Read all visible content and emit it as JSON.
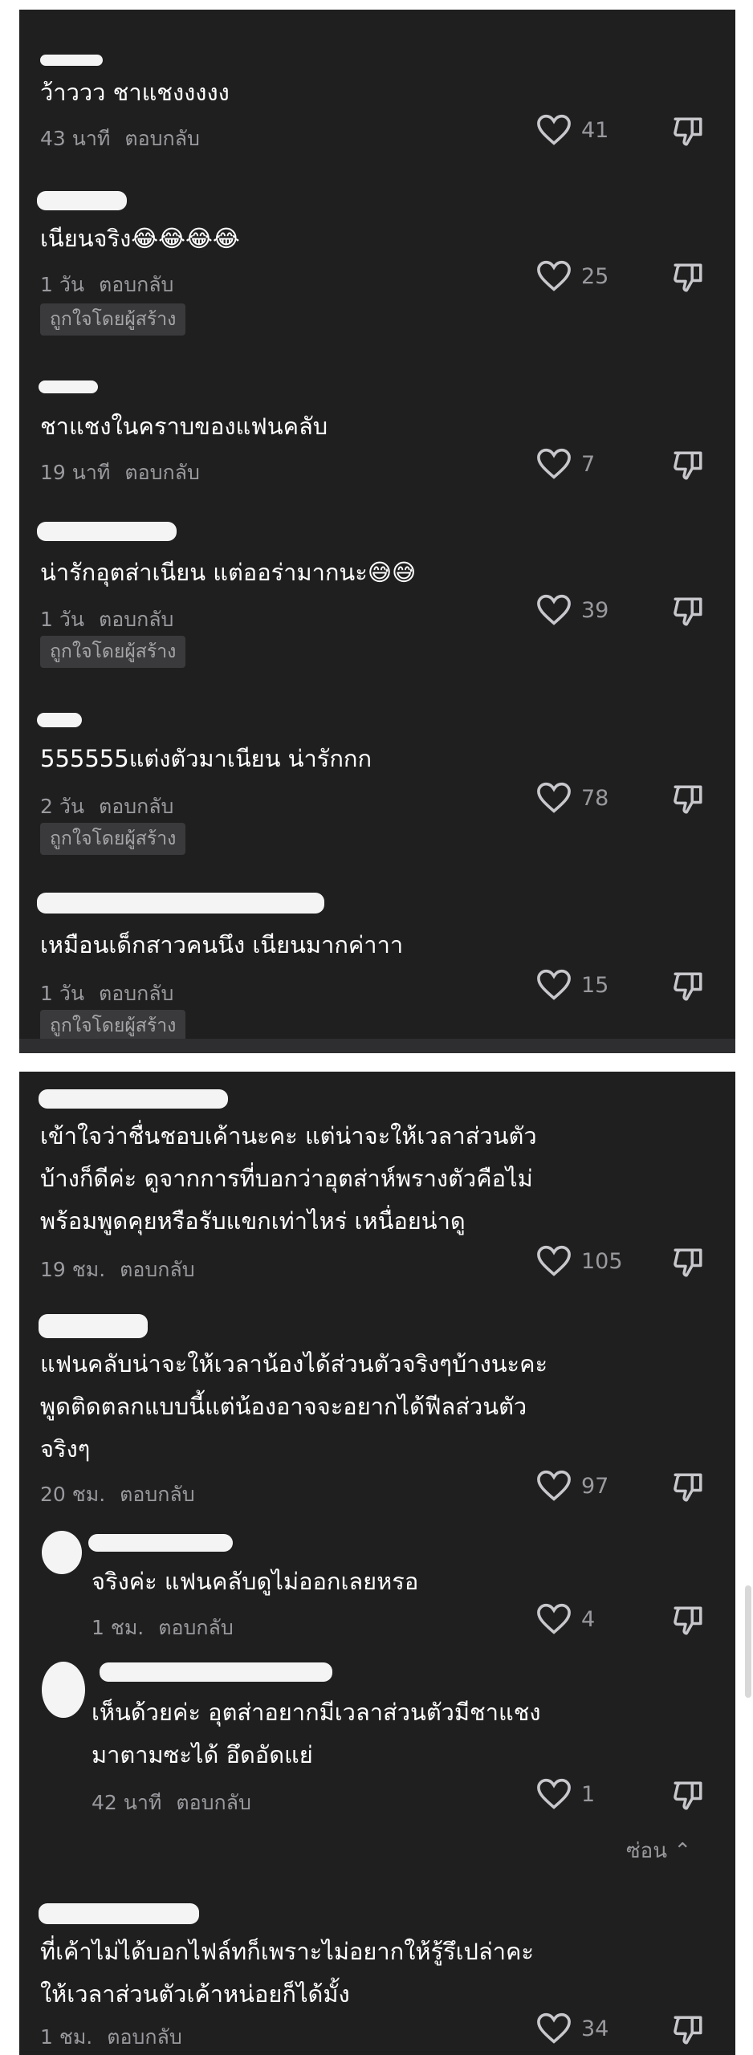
{
  "panel1": {
    "comments": [
      {
        "text": "ว้าววว ชาแชงงงงง",
        "time": "43 นาที",
        "reply": "ตอบกลับ",
        "likes": "41"
      },
      {
        "text": "เนียนจริง😂😂😂😂",
        "time": "1 วัน",
        "reply": "ตอบกลับ",
        "likes": "25",
        "badge": "ถูกใจโดยผู้สร้าง"
      },
      {
        "text": "ชาแชงในคราบของแฟนคลับ",
        "time": "19 นาที",
        "reply": "ตอบกลับ",
        "likes": "7"
      },
      {
        "text": "น่ารักอุตส่าเนียน แต่ออร่ามากนะ😅😅",
        "time": "1 วัน",
        "reply": "ตอบกลับ",
        "likes": "39",
        "badge": "ถูกใจโดยผู้สร้าง"
      },
      {
        "text": "555555แต่งตัวมาเนียน น่ารักกก",
        "time": "2 วัน",
        "reply": "ตอบกลับ",
        "likes": "78",
        "badge": "ถูกใจโดยผู้สร้าง"
      },
      {
        "text": "เหมือนเด็กสาวคนนึง เนียนมากค่าาา",
        "time": "1 วัน",
        "reply": "ตอบกลับ",
        "likes": "15",
        "badge": "ถูกใจโดยผู้สร้าง"
      }
    ]
  },
  "panel2": {
    "comments": [
      {
        "lines": [
          "เข้าใจว่าชื่นชอบเค้านะคะ แต่น่าจะให้เวลาส่วนตัว",
          "บ้างก็ดีค่ะ ดูจากการที่บอกว่าอุตส่าห์พรางตัวคือไม่",
          "พร้อมพูดคุยหรือรับแขกเท่าไหร่ เหนื่อยน่าดู"
        ],
        "time": "19 ชม.",
        "reply": "ตอบกลับ",
        "likes": "105"
      },
      {
        "lines": [
          "แฟนคลับน่าจะให้เวลาน้องได้ส่วนตัวจริงๆบ้างนะคะ",
          "พูดติดตลกแบบนี้แต่น้องอาจจะอยากได้ฟีลส่วนตัว",
          "จริงๆ"
        ],
        "time": "20 ชม.",
        "reply": "ตอบกลับ",
        "likes": "97"
      },
      {
        "lines": [
          "จริงค่ะ แฟนคลับดูไม่ออกเลยหรอ"
        ],
        "time": "1 ชม.",
        "reply": "ตอบกลับ",
        "likes": "4"
      },
      {
        "lines": [
          "เห็นด้วยค่ะ อุตส่าอยากมีเวลาส่วนตัวมีชาแชง",
          "มาตามซะได้ อึดอัดแย่"
        ],
        "time": "42 นาที",
        "reply": "ตอบกลับ",
        "likes": "1"
      },
      {
        "lines": [
          "ที่เค้าไม่ได้บอกไฟล์ทก็เพราะไม่อยากให้รู้รึเปล่าคะ",
          "ให้เวลาส่วนตัวเค้าหน่อยก็ได้มั้ง"
        ],
        "time": "1 ชม.",
        "reply": "ตอบกลับ",
        "likes": "34"
      }
    ],
    "hide_label": "ซ่อน"
  }
}
